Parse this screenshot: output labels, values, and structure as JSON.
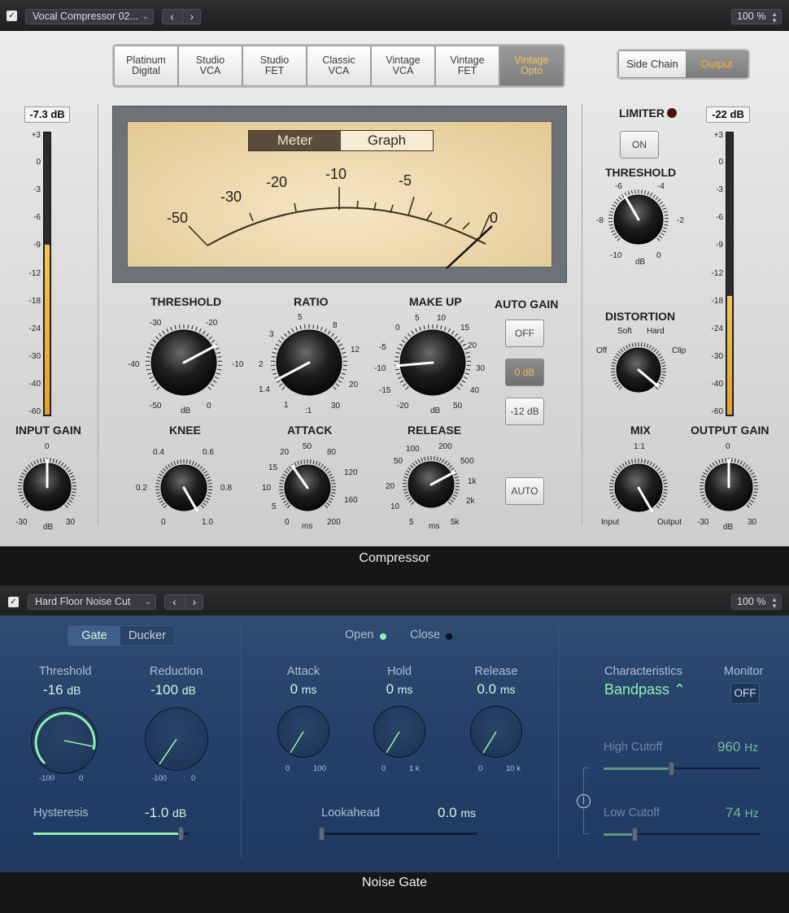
{
  "compressor": {
    "header": {
      "enabled": "✓",
      "preset": "Vocal Compressor 02...",
      "prev": "‹",
      "next": "›",
      "zoom": "100 %"
    },
    "models": [
      {
        "label": "Platinum\nDigital",
        "active": false
      },
      {
        "label": "Studio\nVCA",
        "active": false
      },
      {
        "label": "Studio\nFET",
        "active": false
      },
      {
        "label": "Classic\nVCA",
        "active": false
      },
      {
        "label": "Vintage\nVCA",
        "active": false
      },
      {
        "label": "Vintage\nFET",
        "active": false
      },
      {
        "label": "Vintage\nOpto",
        "active": true
      }
    ],
    "side_chain": "Side Chain",
    "output": "Output",
    "input_value": "-7.3 dB",
    "output_value": "-22 dB",
    "input_meter_level": 0.6,
    "output_meter_level": 0.42,
    "meter_scale": [
      "+3",
      "0",
      "-3",
      "-6",
      "-9",
      "-12",
      "-18",
      "-24",
      "-30",
      "-40",
      "-60"
    ],
    "meter_tabs": {
      "meter": "Meter",
      "graph": "Graph"
    },
    "vu_scale": [
      "-50",
      "-30",
      "-20",
      "-10",
      "-5",
      "0"
    ],
    "threshold": {
      "label": "THRESHOLD",
      "scale": [
        "-30",
        "-20",
        "-40",
        "-10",
        "-50",
        "dB",
        "0"
      ]
    },
    "ratio": {
      "label": "RATIO",
      "scale": [
        "5",
        "3",
        "8",
        "2",
        "12",
        "1.4",
        "20",
        "1",
        ":1",
        "30"
      ]
    },
    "makeup": {
      "label": "MAKE UP",
      "scale": [
        "0",
        "5",
        "10",
        "15",
        "-5",
        "20",
        "-10",
        "30",
        "-15",
        "40",
        "-20",
        "dB",
        "50"
      ]
    },
    "autogain": {
      "label": "AUTO GAIN",
      "off": "OFF",
      "zero": "0 dB",
      "minus12": "-12 dB"
    },
    "knee": {
      "label": "KNEE",
      "scale": [
        "0.4",
        "0.6",
        "0.2",
        "0.8",
        "0",
        "1.0"
      ]
    },
    "attack": {
      "label": "ATTACK",
      "scale": [
        "20",
        "50",
        "80",
        "15",
        "120",
        "10",
        "160",
        "5",
        "0",
        "ms",
        "200"
      ]
    },
    "release": {
      "label": "RELEASE",
      "scale": [
        "100",
        "200",
        "50",
        "500",
        "20",
        "1k",
        "10",
        "2k",
        "5",
        "ms",
        "5k"
      ]
    },
    "auto": "AUTO",
    "input_gain": {
      "label": "INPUT GAIN",
      "scale": [
        "0",
        "-30",
        "dB",
        "30"
      ]
    },
    "limiter": {
      "label": "LIMITER",
      "button": "ON"
    },
    "lim_threshold": {
      "label": "THRESHOLD",
      "scale": [
        "-6",
        "-4",
        "-8",
        "-2",
        "-10",
        "dB",
        "0"
      ]
    },
    "distortion": {
      "label": "DISTORTION",
      "scale": [
        "Soft",
        "Hard",
        "Off",
        "Clip"
      ]
    },
    "mix": {
      "label": "MIX",
      "scale": [
        "1:1",
        "Input",
        "Output"
      ]
    },
    "output_gain": {
      "label": "OUTPUT GAIN",
      "scale": [
        "0",
        "-30",
        "dB",
        "30"
      ]
    },
    "footer": "Compressor"
  },
  "gate": {
    "header": {
      "enabled": "✓",
      "preset": "Hard Floor Noise Cut",
      "prev": "‹",
      "next": "›",
      "zoom": "100 %"
    },
    "mode": {
      "gate": "Gate",
      "ducker": "Ducker"
    },
    "threshold": {
      "label": "Threshold",
      "value": "-16",
      "unit": "dB",
      "min": "-100",
      "max": "0"
    },
    "reduction": {
      "label": "Reduction",
      "value": "-100",
      "unit": "dB",
      "min": "-100",
      "max": "0"
    },
    "hysteresis": {
      "label": "Hysteresis",
      "value": "-1.0",
      "unit": "dB",
      "level": 0.95
    },
    "open": "Open",
    "close": "Close",
    "attack": {
      "label": "Attack",
      "value": "0",
      "unit": "ms",
      "min": "0",
      "max": "100"
    },
    "hold": {
      "label": "Hold",
      "value": "0",
      "unit": "ms",
      "min": "0",
      "max": "1 k"
    },
    "release": {
      "label": "Release",
      "value": "0.0",
      "unit": "ms",
      "min": "0",
      "max": "10 k"
    },
    "lookahead": {
      "label": "Lookahead",
      "value": "0.0",
      "unit": "ms",
      "level": 0.0
    },
    "characteristics": {
      "label": "Characteristics",
      "value": "Bandpass ⌃"
    },
    "monitor": {
      "label": "Monitor",
      "value": "OFF"
    },
    "high_cutoff": {
      "label": "High Cutoff",
      "value": "960",
      "unit": "Hz",
      "level": 0.43
    },
    "low_cutoff": {
      "label": "Low Cutoff",
      "value": "74",
      "unit": "Hz",
      "level": 0.2
    },
    "footer": "Noise Gate"
  }
}
